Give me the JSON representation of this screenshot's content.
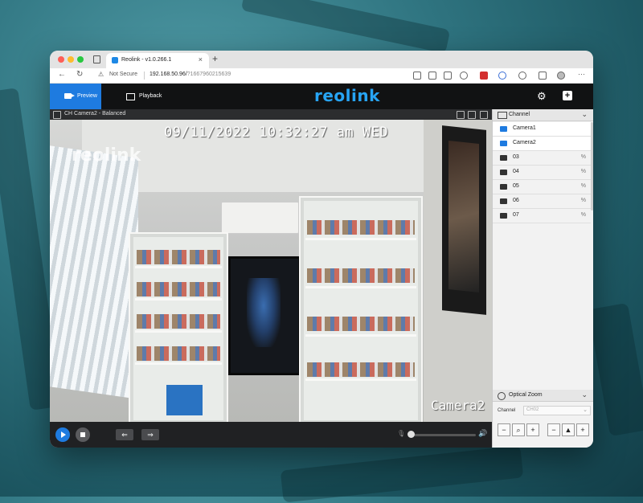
{
  "browser": {
    "tab_title": "Reolink - v1.0.266.1",
    "tab_close": "×",
    "new_tab": "+",
    "security_label": "Not Secure",
    "url_host": "192.168.50.96/",
    "url_path": "?1667960215639",
    "menu": "···"
  },
  "app": {
    "tabs": [
      {
        "label": "Preview",
        "active": true
      },
      {
        "label": "Playback",
        "active": false
      }
    ],
    "logo": "reolink",
    "accent_color": "#1e7be0"
  },
  "video": {
    "header_title": "CH Camera2 - Balanced",
    "osd_timestamp": "09/11/2022 10:32:27 am WED",
    "osd_watermark": "reolink",
    "osd_camera_name": "Camera2"
  },
  "controls": {
    "prev_label": "⇐",
    "next_label": "⇒",
    "mic_icon": "microphone-icon",
    "speaker_icon": "speaker-icon",
    "volume": 0
  },
  "channel_panel": {
    "title": "Channel",
    "channels": [
      {
        "name": "Camera1",
        "status": ""
      },
      {
        "name": "Camera2",
        "status": ""
      },
      {
        "name": "03",
        "status": "%"
      },
      {
        "name": "04",
        "status": "%"
      },
      {
        "name": "05",
        "status": "%"
      },
      {
        "name": "06",
        "status": "%"
      },
      {
        "name": "07",
        "status": "%"
      }
    ]
  },
  "optical_zoom": {
    "title": "Optical Zoom",
    "channel_label": "Channel",
    "channel_value": "CH02",
    "zoom_out": "−",
    "zoom_in": "+",
    "focus_out": "−",
    "focus_in": "+"
  }
}
